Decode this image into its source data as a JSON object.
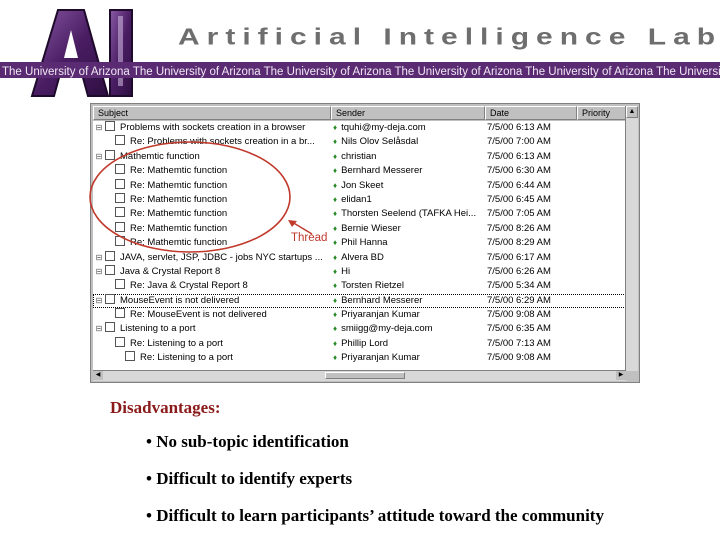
{
  "banner": {
    "logo_text": "AI",
    "title": "Artificial Intelligence Lab",
    "strip_text": "The University of Arizona The University of Arizona The University of Arizona The University of Arizona The University of Arizona The University"
  },
  "colors": {
    "strip": "#5a2a72",
    "heading": "#8b1a1a",
    "annotation": "#c0392b"
  },
  "newsreader": {
    "columns": [
      "Subject",
      "Sender",
      "Date",
      "Priority"
    ],
    "rows": [
      {
        "subject": "Problems with sockets creation in a browser",
        "sender": "tquhi@my-deja.com",
        "date": "7/5/00 6:13 AM",
        "level": 0
      },
      {
        "subject": "Re: Problems with sockets creation in a br...",
        "sender": "Nils Olov Selåsdal",
        "date": "7/5/00 7:00 AM",
        "level": 1
      },
      {
        "subject": "Mathemtic function",
        "sender": "christian",
        "date": "7/5/00 6:13 AM",
        "level": 0
      },
      {
        "subject": "Re: Mathemtic function",
        "sender": "Bernhard Messerer",
        "date": "7/5/00 6:30 AM",
        "level": 1
      },
      {
        "subject": "Re: Mathemtic function",
        "sender": "Jon Skeet",
        "date": "7/5/00 6:44 AM",
        "level": 1
      },
      {
        "subject": "Re: Mathemtic function",
        "sender": "elidan1",
        "date": "7/5/00 6:45 AM",
        "level": 1
      },
      {
        "subject": "Re: Mathemtic function",
        "sender": "Thorsten Seelend (TAFKA Hei...",
        "date": "7/5/00 7:05 AM",
        "level": 1
      },
      {
        "subject": "Re: Mathemtic function",
        "sender": "Bernie Wieser",
        "date": "7/5/00 8:26 AM",
        "level": 1
      },
      {
        "subject": "Re: Mathemtic function",
        "sender": "Phil Hanna",
        "date": "7/5/00 8:29 AM",
        "level": 1
      },
      {
        "subject": "JAVA, servlet, JSP, JDBC - jobs NYC startups ...",
        "sender": "Alvera BD",
        "date": "7/5/00 6:17 AM",
        "level": 0
      },
      {
        "subject": "Java & Crystal Report 8",
        "sender": "Hi",
        "date": "7/5/00 6:26 AM",
        "level": 0
      },
      {
        "subject": "Re: Java & Crystal Report 8",
        "sender": "Torsten Rietzel",
        "date": "7/5/00 5:34 AM",
        "level": 1
      },
      {
        "subject": "MouseEvent is not delivered",
        "sender": "Bernhard Messerer",
        "date": "7/5/00 6:29 AM",
        "level": 0,
        "selected": true
      },
      {
        "subject": "Re: MouseEvent is not delivered",
        "sender": "Priyaranjan Kumar",
        "date": "7/5/00 9:08 AM",
        "level": 1
      },
      {
        "subject": "Listening to a port",
        "sender": "smiigg@my-deja.com",
        "date": "7/5/00 6:35 AM",
        "level": 0
      },
      {
        "subject": "Re: Listening to a port",
        "sender": "Phillip Lord",
        "date": "7/5/00 7:13 AM",
        "level": 1
      },
      {
        "subject": "Re: Listening to a port",
        "sender": "Priyaranjan Kumar",
        "date": "7/5/00 9:08 AM",
        "level": 2
      }
    ]
  },
  "annotation": {
    "label": "Thread"
  },
  "disadvantages": {
    "title": "Disadvantages:",
    "items": [
      "• No sub-topic identification",
      "• Difficult to identify experts",
      "• Difficult to learn participants’ attitude toward the community"
    ]
  }
}
